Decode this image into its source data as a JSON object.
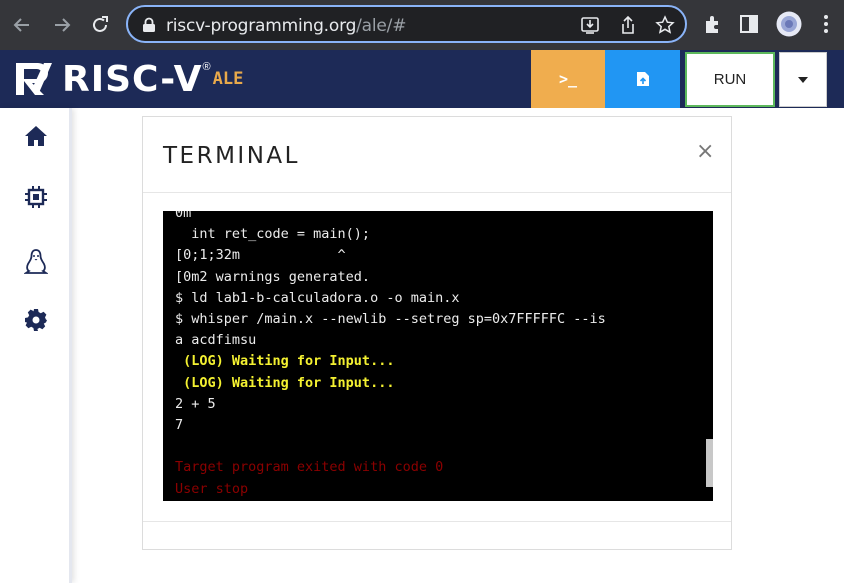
{
  "browser": {
    "url_host": "riscv-programming.org",
    "url_path": "/ale/#",
    "icons": [
      "back-icon",
      "forward-icon",
      "reload-icon",
      "lock-icon",
      "install-icon",
      "share-icon",
      "bookmark-star-icon",
      "extensions-puzzle-icon",
      "side-panel-icon",
      "profile-avatar",
      "more-menu-icon"
    ]
  },
  "header": {
    "logo_text": "RISC-V",
    "logo_reg": "®",
    "logo_suffix": "ALE",
    "terminal_button_label": ">_",
    "run_label": "RUN",
    "colors": {
      "navbar": "#1d2a57",
      "terminal_button": "#f0ad4e",
      "upload_button": "#2196f3",
      "run_border": "#5cb85c"
    }
  },
  "sidebar": {
    "items": [
      {
        "name": "home",
        "icon": "home-icon"
      },
      {
        "name": "chip",
        "icon": "chip-icon"
      },
      {
        "name": "linux",
        "icon": "tux-icon"
      },
      {
        "name": "settings",
        "icon": "gear-icon"
      }
    ]
  },
  "modal": {
    "title": "TERMINAL",
    "close": "×"
  },
  "terminal": {
    "lines": [
      {
        "text": "0m",
        "style": "normal"
      },
      {
        "text": "  int ret_code = main();",
        "style": "normal"
      },
      {
        "text": "[0;1;32m            ^",
        "style": "normal"
      },
      {
        "text": "[0m2 warnings generated.",
        "style": "normal"
      },
      {
        "text": "$ ld lab1-b-calculadora.o -o main.x",
        "style": "normal"
      },
      {
        "text": "$ whisper /main.x --newlib --setreg sp=0x7FFFFFC --is",
        "style": "normal"
      },
      {
        "text": "a acdfimsu",
        "style": "normal"
      },
      {
        "text": " (LOG) Waiting for Input...",
        "style": "yellow"
      },
      {
        "text": " (LOG) Waiting for Input...",
        "style": "yellow"
      },
      {
        "text": "2 + 5",
        "style": "normal"
      },
      {
        "text": "7",
        "style": "normal"
      },
      {
        "text": "",
        "style": "normal"
      },
      {
        "text": "Target program exited with code 0",
        "style": "red"
      },
      {
        "text": "User stop",
        "style": "red"
      }
    ]
  }
}
